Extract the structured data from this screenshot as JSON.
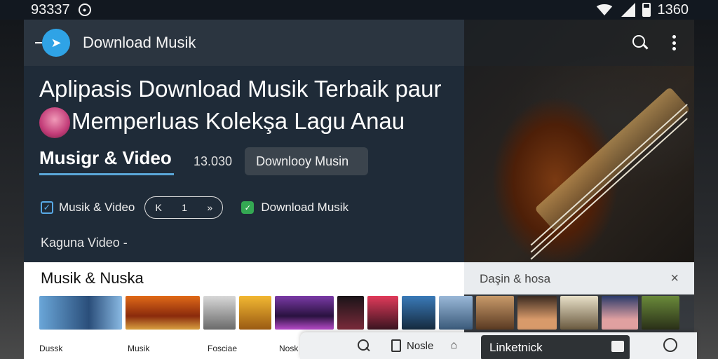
{
  "status_bar": {
    "time": "93337",
    "right_text": "1360"
  },
  "app_bar": {
    "title": "Download Musik"
  },
  "hero": {
    "headline_line1": "Aplipasis Download Musik Terbaik paur",
    "headline_line2": "Memperluas Kolekşa Lagu Anau"
  },
  "tabs": {
    "active": "Musigr & Video",
    "count": "13.030",
    "download_button": "Downlooy Musin"
  },
  "filters": {
    "check1": "Musik & Video",
    "check2": "Download Musik",
    "player_prev": "K",
    "player_play": "1",
    "player_next": "»"
  },
  "video_label": "Kaguna Video -",
  "section": {
    "title": "Musik & Nuska",
    "panel_title": "Daşin & hosa",
    "close": "×"
  },
  "thumb_labels": [
    "Dussk",
    "Musik",
    "Fosciae",
    "Nosk"
  ],
  "toolbar": {
    "doc_label": "Nosle",
    "field_text": "Linketnick"
  },
  "colors": {
    "accent": "#2fa3e6",
    "tab_underline": "#5aa7d8",
    "check_green": "#34a853"
  }
}
